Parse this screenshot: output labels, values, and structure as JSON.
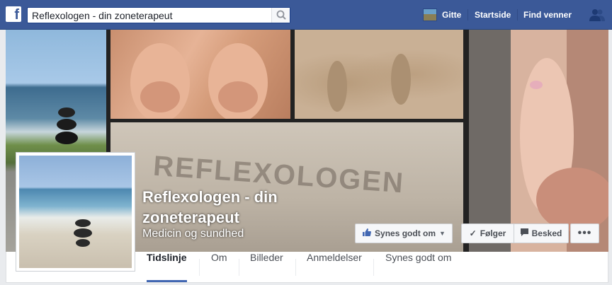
{
  "topbar": {
    "logo": "f",
    "search_value": "Reflexologen - din zoneterapeut",
    "user_name": "Gitte",
    "home_label": "Startside",
    "find_friends_label": "Find venner"
  },
  "cover": {
    "sand_text": "REFLEXOLOGEN"
  },
  "page": {
    "title": "Reflexologen - din zoneterapeut",
    "category": "Medicin og sundhed"
  },
  "actions": {
    "like_label": "Synes godt om",
    "follow_label": "Følger",
    "message_label": "Besked",
    "more_label": "•••"
  },
  "tabs": [
    {
      "label": "Tidslinje",
      "active": true
    },
    {
      "label": "Om"
    },
    {
      "label": "Billeder"
    },
    {
      "label": "Anmeldelser"
    },
    {
      "label": "Synes godt om"
    }
  ],
  "colors": {
    "brand": "#3b5998",
    "tab_active_underline": "#4267b2"
  }
}
